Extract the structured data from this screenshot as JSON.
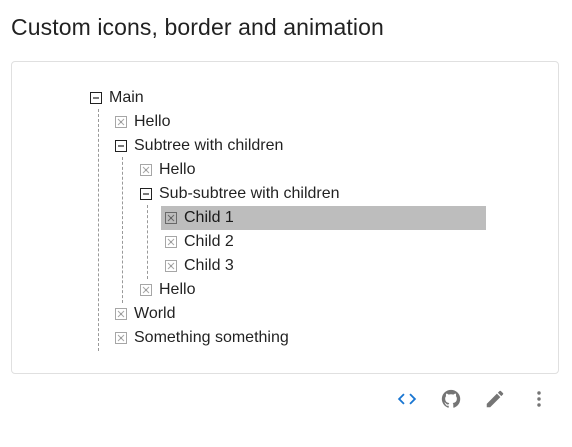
{
  "page": {
    "title": "Custom icons, border and animation"
  },
  "tree": {
    "selected_color": "#bdbdbd",
    "nodes": [
      {
        "id": "main",
        "label": "Main",
        "kind": "collapse"
      },
      {
        "id": "hello-1",
        "label": "Hello",
        "kind": "close"
      },
      {
        "id": "subtree",
        "label": "Subtree with children",
        "kind": "collapse"
      },
      {
        "id": "hello-2",
        "label": "Hello",
        "kind": "close"
      },
      {
        "id": "sub-subtree",
        "label": "Sub-subtree with children",
        "kind": "collapse"
      },
      {
        "id": "child-1",
        "label": "Child 1",
        "kind": "close",
        "selected": true
      },
      {
        "id": "child-2",
        "label": "Child 2",
        "kind": "close"
      },
      {
        "id": "child-3",
        "label": "Child 3",
        "kind": "close"
      },
      {
        "id": "hello-3",
        "label": "Hello",
        "kind": "close"
      },
      {
        "id": "world",
        "label": "World",
        "kind": "close"
      },
      {
        "id": "something",
        "label": "Something something",
        "kind": "close"
      }
    ]
  },
  "toolbar": {
    "code_icon": "code-icon",
    "github_icon": "github-icon",
    "edit_icon": "pencil-icon",
    "more_icon": "more-vert-icon",
    "accent": "#1976d2"
  }
}
